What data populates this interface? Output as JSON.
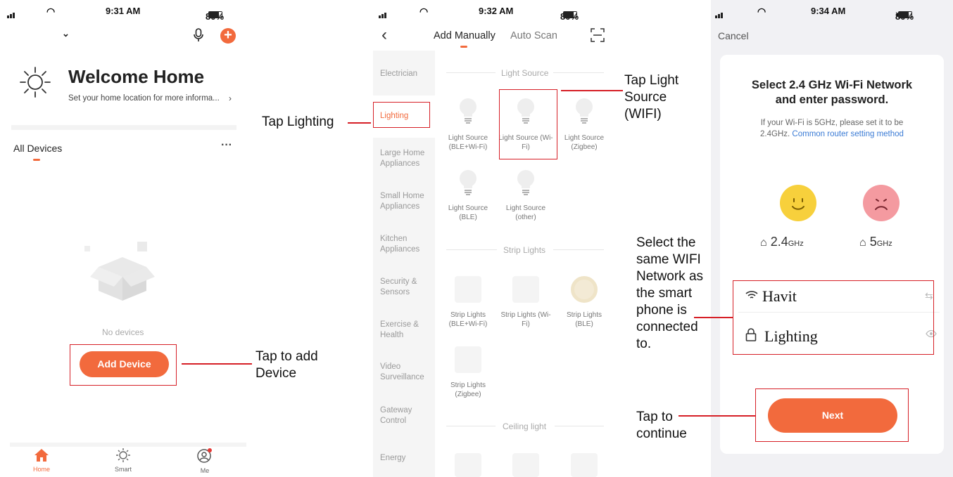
{
  "screen1": {
    "status": {
      "time": "9:31 AM",
      "battery": "80%"
    },
    "welcome_title": "Welcome Home",
    "welcome_sub": "Set your home location for more informa...",
    "all_devices": "All Devices",
    "more": "···",
    "no_devices": "No devices",
    "add_device": "Add Device",
    "nav": [
      {
        "label": "Home"
      },
      {
        "label": "Smart"
      },
      {
        "label": "Me"
      }
    ],
    "accent": "#f26a3d"
  },
  "screen2": {
    "status": {
      "time": "9:32 AM",
      "battery": "80%"
    },
    "tabs": [
      {
        "label": "Add Manually"
      },
      {
        "label": "Auto Scan"
      }
    ],
    "categories": [
      "Electrician",
      "Lighting",
      "Large Home Appliances",
      "Small Home Appliances",
      "Kitchen Appliances",
      "Security & Sensors",
      "Exercise & Health",
      "Video Surveillance",
      "Gateway Control",
      "Energy"
    ],
    "sections": [
      {
        "title": "Light Source",
        "items": [
          "Light Source (BLE+Wi-Fi)",
          "Light Source (Wi-Fi)",
          "Light Source (Zigbee)",
          "Light Source (BLE)",
          "Light Source (other)"
        ]
      },
      {
        "title": "Strip Lights",
        "items": [
          "Strip Lights (BLE+Wi-Fi)",
          "Strip Lights (Wi-Fi)",
          "Strip Lights (BLE)",
          "Strip Lights (Zigbee)"
        ]
      },
      {
        "title": "Ceiling light",
        "items": []
      }
    ]
  },
  "screen3": {
    "status": {
      "time": "9:34 AM",
      "battery": "80%"
    },
    "cancel": "Cancel",
    "title_line1": "Select 2.4 GHz Wi-Fi Network",
    "title_line2": "and enter password.",
    "info_line1": "If your Wi-Fi is 5GHz, please set it to be",
    "info_line2_plain": "2.4GHz.",
    "info_link": "Common router setting method",
    "band_good": "2.4",
    "band_good_unit": "GHz",
    "band_bad": "5",
    "band_bad_unit": "GHz",
    "wifi_name": "Havit",
    "password": "Lighting",
    "next": "Next"
  },
  "annotations": {
    "tap_lighting": "Tap Lighting",
    "tap_light_source": [
      "Tap Light",
      "Source",
      "(WIFI)"
    ],
    "tap_add_device": [
      "Tap to add",
      "Device"
    ],
    "select_wifi": [
      "Select the",
      "same WIFI",
      "Network as",
      "the smart",
      "phone is",
      "connected",
      "to."
    ],
    "tap_continue": [
      "Tap to",
      "continue"
    ]
  },
  "colors": {
    "accent": "#f26a3d",
    "annotation_red": "#d61f26",
    "link_blue": "#3a7bd5"
  }
}
